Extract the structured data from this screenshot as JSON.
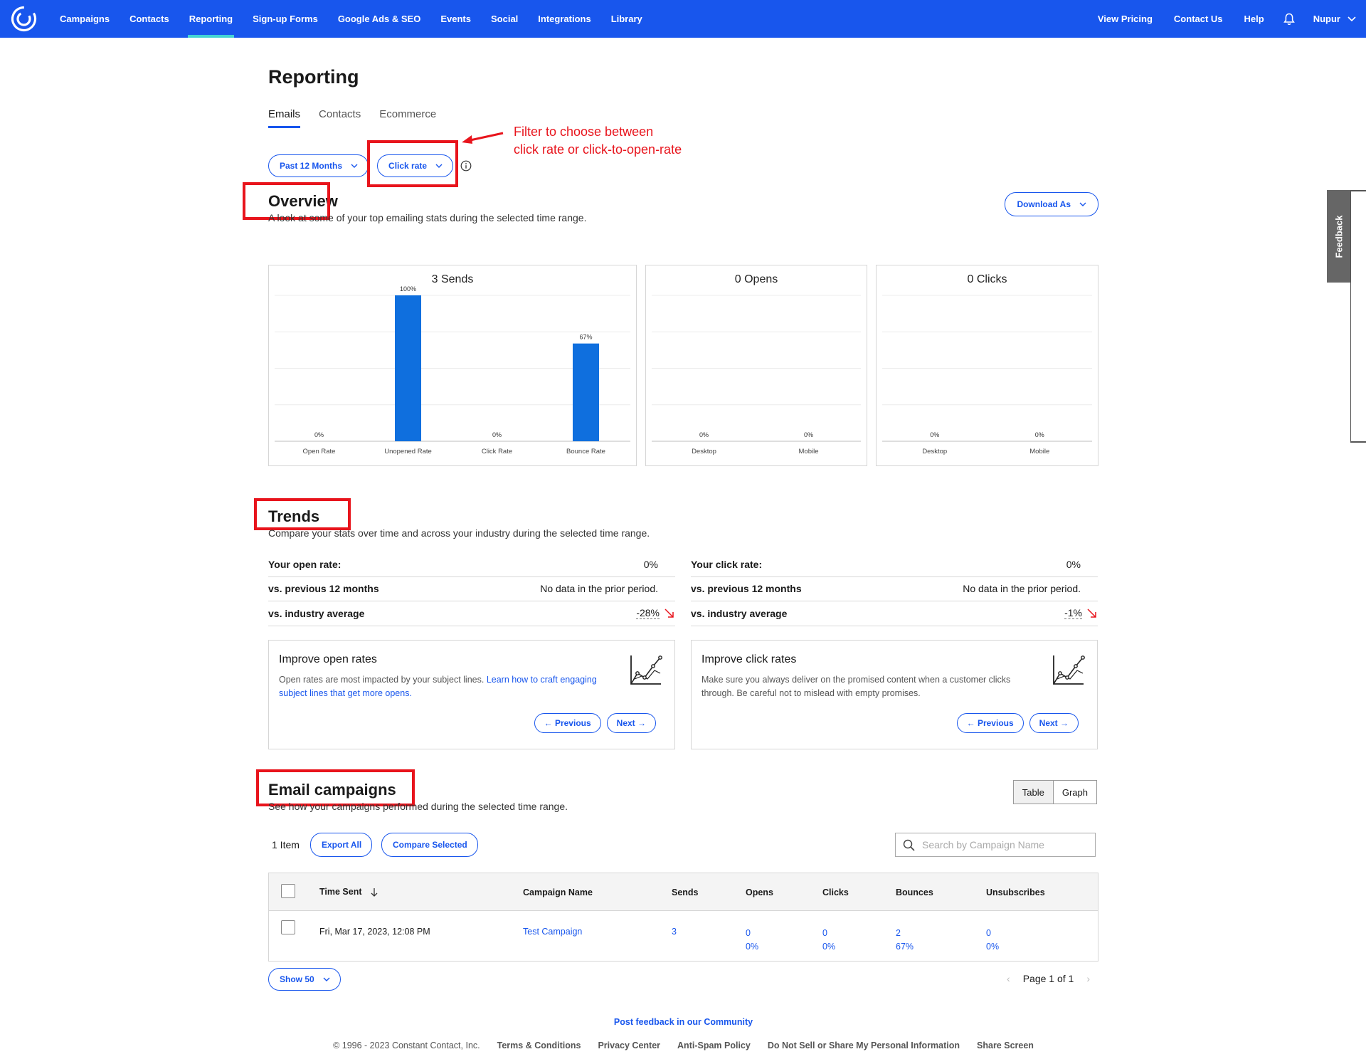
{
  "nav": {
    "left": [
      "Campaigns",
      "Contacts",
      "Reporting",
      "Sign-up Forms",
      "Google Ads & SEO",
      "Events",
      "Social",
      "Integrations",
      "Library"
    ],
    "right": [
      "View Pricing",
      "Contact Us",
      "Help"
    ],
    "user": "Nupur",
    "active": "Reporting"
  },
  "page": {
    "title": "Reporting",
    "tabs": [
      "Emails",
      "Contacts",
      "Ecommerce"
    ],
    "filters": {
      "period": "Past 12 Months",
      "metric": "Click rate"
    },
    "annotation": [
      "Filter to choose between",
      "click rate or click-to-open-rate"
    ]
  },
  "overview": {
    "title": "Overview",
    "subtitle": "A look at some of your top emailing stats during the selected time range.",
    "download": "Download As"
  },
  "chart_data": [
    {
      "type": "bar",
      "title": "3 Sends",
      "categories": [
        "Open Rate",
        "Unopened Rate",
        "Click Rate",
        "Bounce Rate"
      ],
      "values": [
        0,
        100,
        0,
        67
      ],
      "value_labels": [
        "0%",
        "100%",
        "0%",
        "67%"
      ],
      "ylim": [
        0,
        100
      ],
      "grid": true,
      "color": "#0f6fde"
    },
    {
      "type": "bar",
      "title": "0 Opens",
      "categories": [
        "Desktop",
        "Mobile"
      ],
      "values": [
        0,
        0
      ],
      "value_labels": [
        "0%",
        "0%"
      ],
      "ylim": [
        0,
        100
      ],
      "grid": true,
      "color": "#0f6fde"
    },
    {
      "type": "bar",
      "title": "0 Clicks",
      "categories": [
        "Desktop",
        "Mobile"
      ],
      "values": [
        0,
        0
      ],
      "value_labels": [
        "0%",
        "0%"
      ],
      "ylim": [
        0,
        100
      ],
      "grid": true,
      "color": "#0f6fde"
    }
  ],
  "trends": {
    "title": "Trends",
    "subtitle": "Compare your stats over time and across your industry during the selected time range.",
    "open": {
      "label": "Your open rate:",
      "value": "0%",
      "prev_label": "vs. previous 12 months",
      "prev_value": "No data in the prior period.",
      "industry_label": "vs. industry average",
      "industry_value": "-28%"
    },
    "click": {
      "label": "Your click rate:",
      "value": "0%",
      "prev_label": "vs. previous 12 months",
      "prev_value": "No data in the prior period.",
      "industry_label": "vs. industry average",
      "industry_value": "-1%"
    },
    "improve_open": {
      "title": "Improve open rates",
      "text": "Open rates are most impacted by your subject lines. ",
      "link": "Learn how to craft engaging subject lines that get more opens."
    },
    "improve_click": {
      "title": "Improve click rates",
      "text": "Make sure you always deliver on the promised content when a customer clicks through. Be careful not to mislead with empty promises."
    },
    "prev": "← Previous",
    "next": "Next →"
  },
  "campaigns": {
    "title": "Email campaigns",
    "subtitle": "See how your campaigns performed during the selected time range.",
    "view_table": "Table",
    "view_graph": "Graph",
    "count": "1 Item",
    "export": "Export All",
    "compare": "Compare Selected",
    "search_placeholder": "Search by Campaign Name",
    "columns": [
      "Time Sent",
      "Campaign Name",
      "Sends",
      "Opens",
      "Clicks",
      "Bounces",
      "Unsubscribes"
    ],
    "rows": [
      {
        "time": "Fri, Mar 17, 2023, 12:08 PM",
        "name": "Test Campaign",
        "sends": "3",
        "opens": "0",
        "opens_pct": "0%",
        "clicks": "0",
        "clicks_pct": "0%",
        "bounces": "2",
        "bounces_pct": "67%",
        "unsubs": "0",
        "unsubs_pct": "0%"
      }
    ],
    "show": "Show 50",
    "page": "Page 1 of 1"
  },
  "footer": {
    "feedback_link": "Post feedback in our Community",
    "copyright": "© 1996 - 2023 Constant Contact, Inc.",
    "links": [
      "Terms & Conditions",
      "Privacy Center",
      "Anti-Spam Policy",
      "Do Not Sell or Share My Personal Information",
      "Share Screen"
    ]
  },
  "feedback_tab": "Feedback",
  "colors": {
    "brand": "#1856ed",
    "annotation": "#e8141c",
    "bar": "#0f6fde",
    "active_tab": "#44d3d3"
  }
}
